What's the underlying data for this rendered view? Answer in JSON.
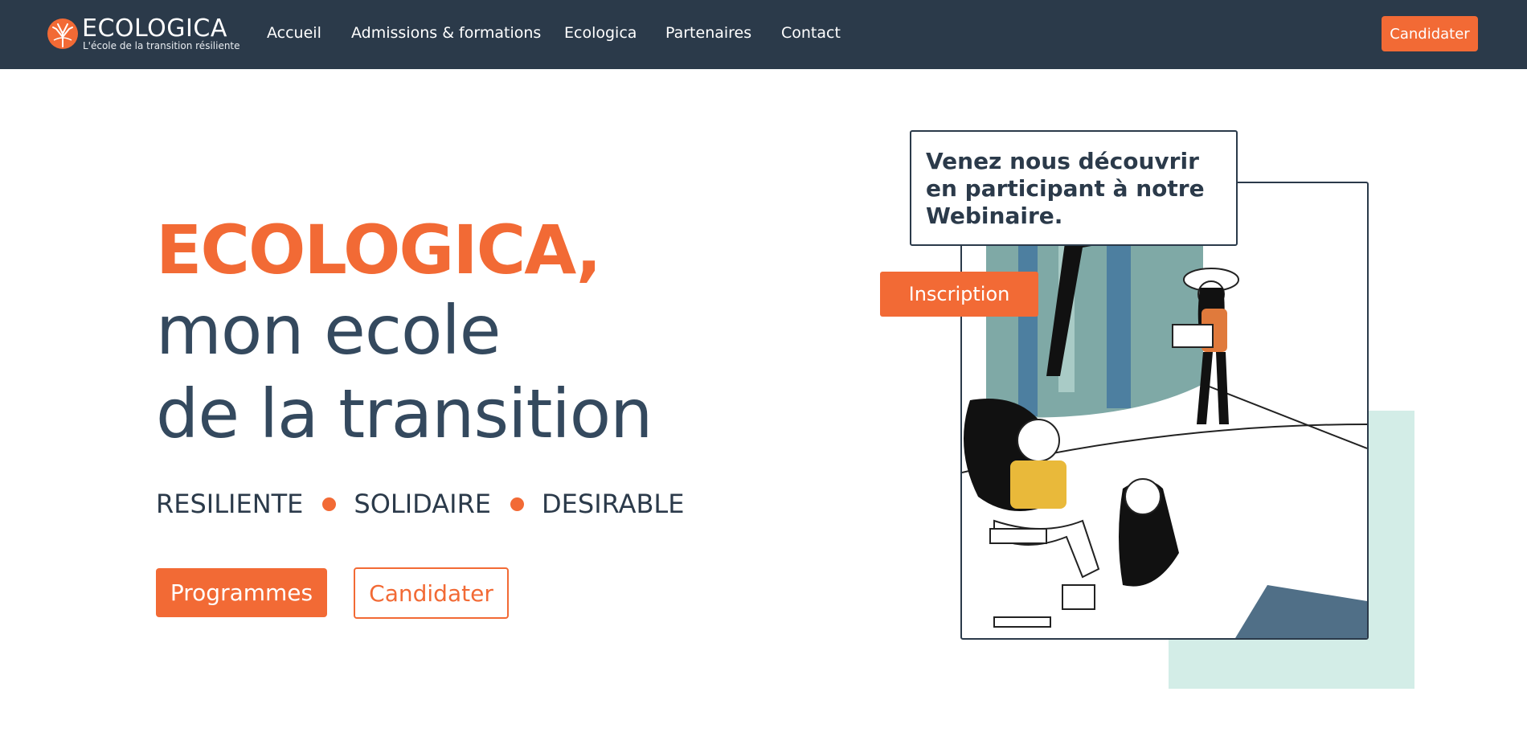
{
  "nav": {
    "logo_name": "ECOLOGICA",
    "logo_tagline": "L'école de la transition résiliente",
    "items": [
      {
        "label": "Accueil"
      },
      {
        "label": "Admissions & formations"
      },
      {
        "label": "Ecologica"
      },
      {
        "label": "Partenaires"
      },
      {
        "label": "Contact"
      }
    ],
    "cta_label": "Candidater"
  },
  "hero": {
    "title": "ECOLOGICA,",
    "line1": "mon ecole",
    "line2": "de la transition",
    "values": [
      "RESILIENTE",
      "SOLIDAIRE",
      "DESIRABLE"
    ],
    "primary_button": "Programmes",
    "secondary_button": "Candidater"
  },
  "webinar": {
    "callout_text": "Venez nous découvrir en participant à notre Webinaire.",
    "button_label": "Inscription"
  },
  "colors": {
    "accent": "#f26a35",
    "nav_bg": "#2b3a4a",
    "text_dark": "#34495e",
    "mint": "#d3ede7"
  },
  "icons": {
    "logo": "tree-logo-icon",
    "bullet": "dot-icon",
    "illustration": "students-illustration"
  }
}
